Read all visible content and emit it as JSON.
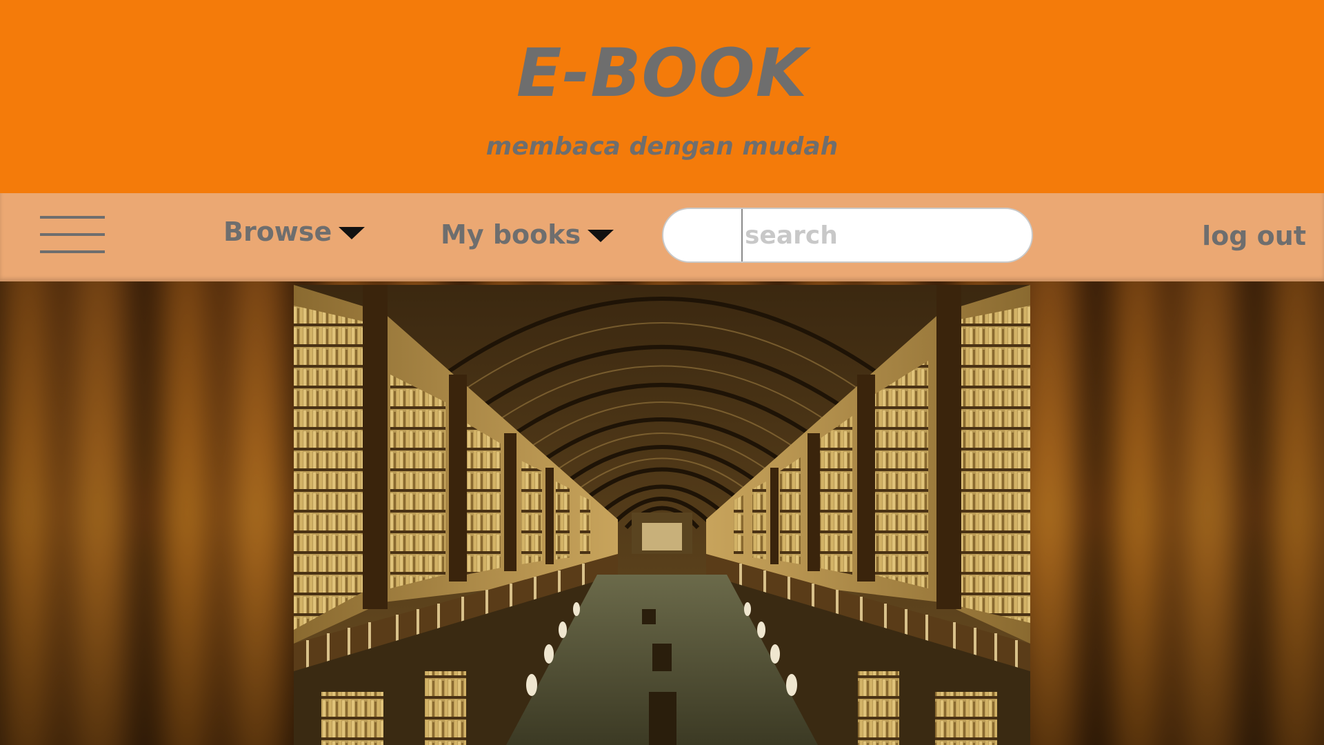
{
  "header": {
    "title": "E-BOOK",
    "tagline": "membaca dengan mudah"
  },
  "navbar": {
    "menu_icon": "hamburger-menu-icon",
    "items": [
      {
        "label": "Browse",
        "icon": "caret-down-icon"
      },
      {
        "label": "My books",
        "icon": "caret-down-icon"
      }
    ],
    "search": {
      "value": "",
      "placeholder": "search"
    },
    "logout_label": "log out"
  },
  "hero": {
    "image_alt": "library-hall-photo"
  },
  "colors": {
    "header_bg": "#f47b0a",
    "navbar_bg": "#eba873",
    "text_gray": "#6e6e6e"
  }
}
